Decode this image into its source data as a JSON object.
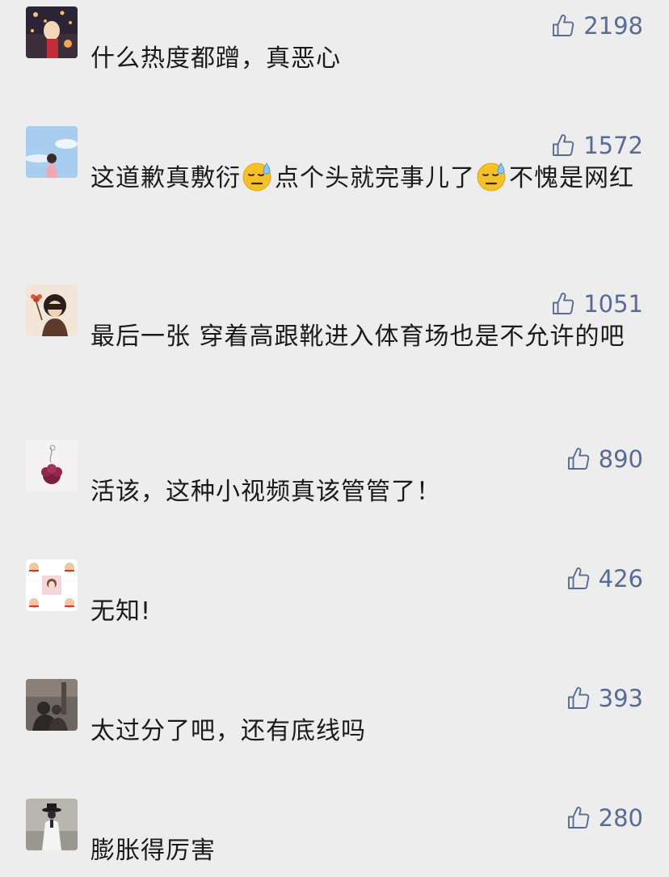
{
  "colors": {
    "background": "#ededed",
    "like_accent": "#576b95",
    "text": "#1a1a1a"
  },
  "comments": [
    {
      "avatar": "night-sky-lanterns-avatar",
      "likes": "2198",
      "text": [
        "什么热度都蹭，真恶心"
      ]
    },
    {
      "avatar": "sky-girl-avatar",
      "likes": "1572",
      "text": [
        "这道歉真敷衍",
        "点个头就完事儿了",
        "不愧是网红"
      ],
      "emoji": "downcast-face-with-sweat-emoji"
    },
    {
      "avatar": "cartoon-girl-flower-avatar",
      "likes": "1051",
      "text": [
        "最后一张 穿着高跟靴进入体育场也是不允许的吧"
      ]
    },
    {
      "avatar": "flower-bouquet-avatar",
      "likes": "890",
      "text": [
        "活该，这种小视频真该管管了！"
      ]
    },
    {
      "avatar": "sticker-collage-avatar",
      "likes": "426",
      "text": [
        "无知!"
      ]
    },
    {
      "avatar": "street-photo-avatar",
      "likes": "393",
      "text": [
        "太过分了吧，还有底线吗"
      ]
    },
    {
      "avatar": "hat-figure-avatar",
      "likes": "280",
      "text": [
        "膨胀得厉害"
      ]
    }
  ]
}
